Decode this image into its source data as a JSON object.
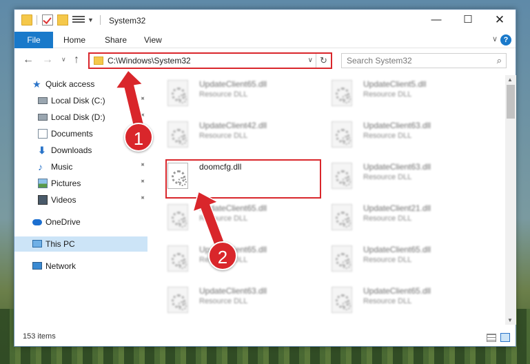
{
  "window": {
    "title": "System32",
    "controls": {
      "minimize": "—",
      "maximize": "☐",
      "close": "✕"
    }
  },
  "ribbon": {
    "tabs": [
      "File",
      "Home",
      "Share",
      "View"
    ],
    "help": "?"
  },
  "navigation": {
    "back": "←",
    "forward": "→",
    "recent": "∨",
    "up": "↑"
  },
  "address": {
    "path": "C:\\Windows\\System32",
    "dropdown": "∨",
    "refresh": "↻"
  },
  "search": {
    "placeholder": "Search System32",
    "icon": "⌕"
  },
  "sidebar": {
    "items": [
      {
        "label": "Quick access",
        "icon": "star-icon",
        "pinned": false
      },
      {
        "label": "Local Disk (C:)",
        "icon": "drive-icon",
        "pinned": true
      },
      {
        "label": "Local Disk (D:)",
        "icon": "drive-icon",
        "pinned": true
      },
      {
        "label": "Documents",
        "icon": "document-icon",
        "pinned": true
      },
      {
        "label": "Downloads",
        "icon": "download-icon",
        "pinned": true
      },
      {
        "label": "Music",
        "icon": "music-icon",
        "pinned": true
      },
      {
        "label": "Pictures",
        "icon": "pictures-icon",
        "pinned": true
      },
      {
        "label": "Videos",
        "icon": "videos-icon",
        "pinned": true
      },
      {
        "label": "OneDrive",
        "icon": "cloud-icon",
        "pinned": false
      },
      {
        "label": "This PC",
        "icon": "computer-icon",
        "pinned": false,
        "selected": true
      },
      {
        "label": "Network",
        "icon": "network-icon",
        "pinned": false
      }
    ],
    "pin_glyph": "📌"
  },
  "files": {
    "left_column": [
      {
        "name": "UpdateClient65.dll",
        "type": "Resource DLL",
        "blurred": true
      },
      {
        "name": "UpdateClient42.dll",
        "type": "Resource DLL",
        "blurred": true
      },
      {
        "name": "doomcfg.dll",
        "type": "",
        "blurred": false,
        "highlighted": true
      },
      {
        "name": "UpdateClient65.dll",
        "type": "Resource DLL",
        "blurred": true
      },
      {
        "name": "UpdateClient65.dll",
        "type": "Resource DLL",
        "blurred": true
      },
      {
        "name": "UpdateClient63.dll",
        "type": "Resource DLL",
        "blurred": true
      }
    ],
    "right_column": [
      {
        "name": "UpdateClient5.dll",
        "type": "Resource DLL",
        "blurred": true
      },
      {
        "name": "UpdateClient63.dll",
        "type": "Resource DLL",
        "blurred": true
      },
      {
        "name": "UpdateClient63.dll",
        "type": "Resource DLL",
        "blurred": true
      },
      {
        "name": "UpdateClient21.dll",
        "type": "Resource DLL",
        "blurred": true
      },
      {
        "name": "UpdateClient65.dll",
        "type": "Resource DLL",
        "blurred": true
      },
      {
        "name": "UpdateClient65.dll",
        "type": "Resource DLL",
        "blurred": true
      }
    ]
  },
  "statusbar": {
    "item_count": "153 items"
  },
  "annotations": {
    "step1": "1",
    "step2": "2",
    "color": "#d9262b"
  },
  "colors": {
    "accent": "#1979ca",
    "selection": "#cce4f7",
    "highlight": "#d9262b"
  }
}
